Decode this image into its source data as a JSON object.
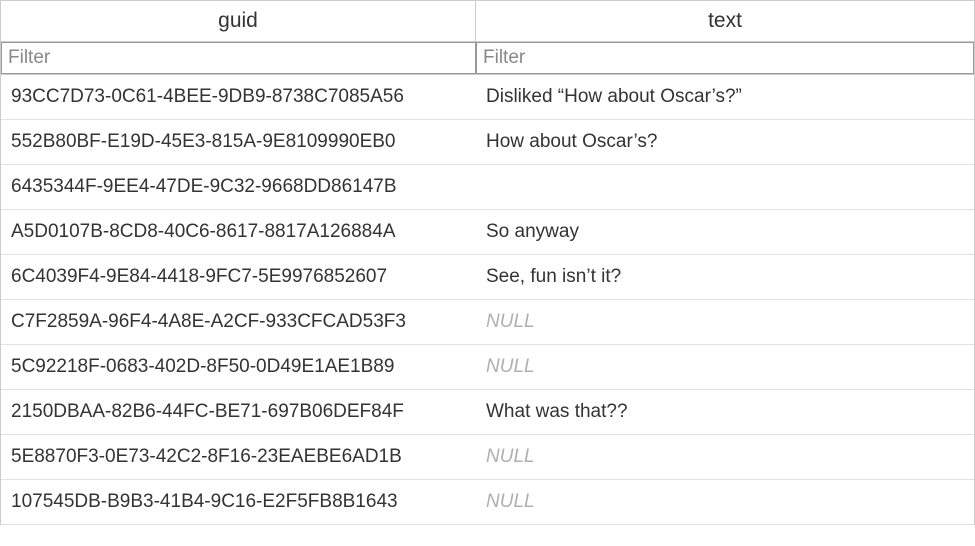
{
  "table": {
    "columns": {
      "guid": {
        "header": "guid",
        "filter_placeholder": "Filter"
      },
      "text": {
        "header": "text",
        "filter_placeholder": "Filter"
      }
    },
    "null_label": "NULL",
    "rows": [
      {
        "guid": "93CC7D73-0C61-4BEE-9DB9-8738C7085A56",
        "text": "Disliked “How about Oscar’s?”",
        "text_is_null": false
      },
      {
        "guid": "552B80BF-E19D-45E3-815A-9E8109990EB0",
        "text": "How about Oscar’s?",
        "text_is_null": false
      },
      {
        "guid": "6435344F-9EE4-47DE-9C32-9668DD86147B",
        "text": "",
        "text_is_null": false
      },
      {
        "guid": "A5D0107B-8CD8-40C6-8617-8817A126884A",
        "text": "So anyway",
        "text_is_null": false
      },
      {
        "guid": "6C4039F4-9E84-4418-9FC7-5E9976852607",
        "text": "See, fun isn’t it?",
        "text_is_null": false
      },
      {
        "guid": "C7F2859A-96F4-4A8E-A2CF-933CFCAD53F3",
        "text": null,
        "text_is_null": true
      },
      {
        "guid": "5C92218F-0683-402D-8F50-0D49E1AE1B89",
        "text": null,
        "text_is_null": true
      },
      {
        "guid": "2150DBAA-82B6-44FC-BE71-697B06DEF84F",
        "text": "What was that??",
        "text_is_null": false
      },
      {
        "guid": "5E8870F3-0E73-42C2-8F16-23EAEBE6AD1B",
        "text": null,
        "text_is_null": true
      },
      {
        "guid": "107545DB-B9B3-41B4-9C16-E2F5FB8B1643",
        "text": null,
        "text_is_null": true
      }
    ]
  }
}
